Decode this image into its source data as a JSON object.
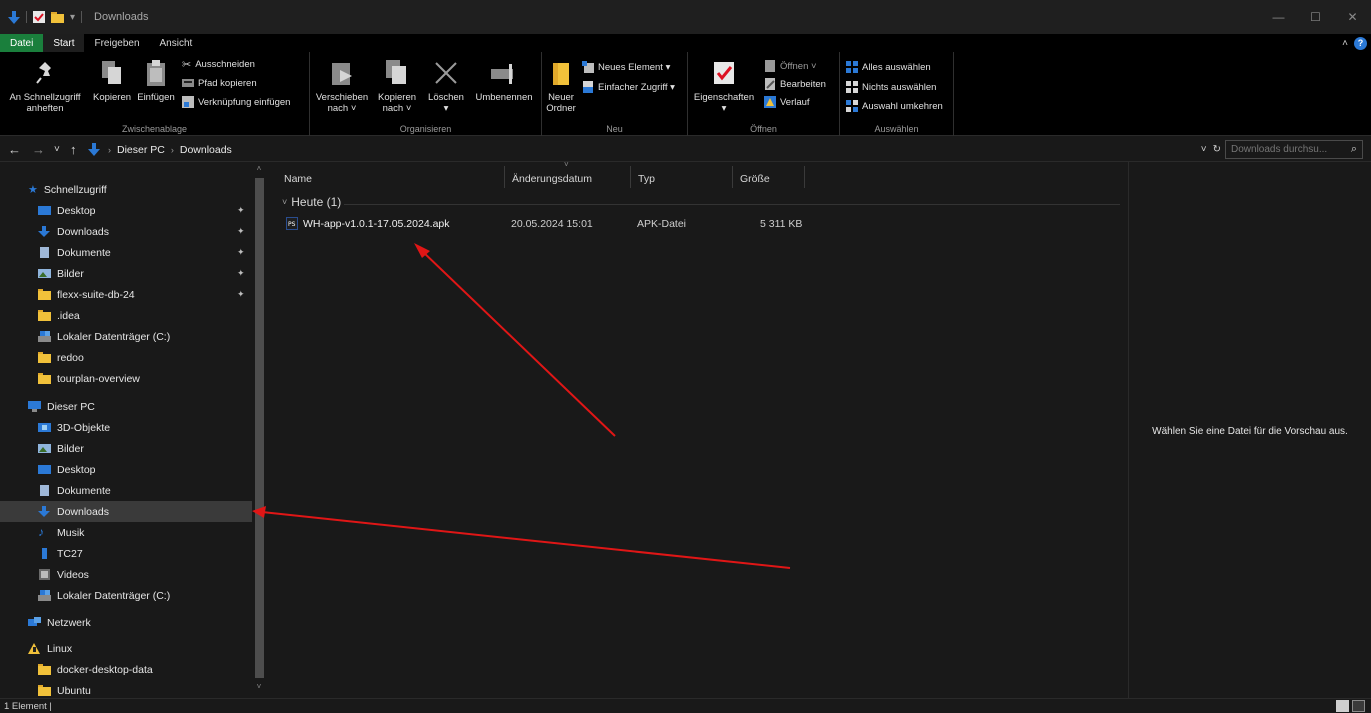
{
  "window": {
    "title": "Downloads",
    "controls": {
      "minimize": "—",
      "maximize": "☐",
      "close": "✕"
    }
  },
  "ribbon_tabs": [
    "Datei",
    "Start",
    "Freigeben",
    "Ansicht"
  ],
  "ribbon": {
    "zwischenablage": {
      "label": "Zwischenablage",
      "pin_quick": "An Schnellzugriff",
      "pin_quick2": "anheften",
      "copy": "Kopieren",
      "paste": "Einfügen",
      "cut": "Ausschneiden",
      "copy_path": "Pfad kopieren",
      "paste_shortcut": "Verknüpfung einfügen"
    },
    "organisieren": {
      "label": "Organisieren",
      "move_to": "Verschieben",
      "move_to2": "nach ˅",
      "copy_to": "Kopieren",
      "copy_to2": "nach ˅",
      "delete": "Löschen",
      "delete2": "▾",
      "rename": "Umbenennen"
    },
    "neu": {
      "label": "Neu",
      "new_folder": "Neuer",
      "new_folder2": "Ordner",
      "new_item": "Neues Element ▾",
      "easy_access": "Einfacher Zugriff ▾"
    },
    "oeffnen": {
      "label": "Öffnen",
      "properties": "Eigenschaften",
      "properties2": "▾",
      "open": "Öffnen ˅",
      "edit": "Bearbeiten",
      "history": "Verlauf"
    },
    "auswaehlen": {
      "label": "Auswählen",
      "select_all": "Alles auswählen",
      "select_none": "Nichts auswählen",
      "invert": "Auswahl umkehren"
    }
  },
  "address": {
    "back": "←",
    "forward": "→",
    "recent": "˅",
    "up": "↑",
    "crumbs": [
      "Dieser PC",
      "Downloads"
    ],
    "sep": "›",
    "dropdown": "˅",
    "refresh": "↻",
    "search_placeholder": "Downloads durchsu...",
    "search_icon": "⌕"
  },
  "nav": {
    "quick_access": "Schnellzugriff",
    "quick_items": [
      "Desktop",
      "Downloads",
      "Dokumente",
      "Bilder",
      "flexx-suite-db-24",
      ".idea",
      "Lokaler Datenträger (C:)",
      "redoo",
      "tourplan-overview"
    ],
    "this_pc": "Dieser PC",
    "pc_items": [
      "3D-Objekte",
      "Bilder",
      "Desktop",
      "Dokumente",
      "Downloads",
      "Musik",
      "TC27",
      "Videos",
      "Lokaler Datenträger (C:)"
    ],
    "network": "Netzwerk",
    "linux": "Linux",
    "linux_items": [
      "docker-desktop-data",
      "Ubuntu"
    ],
    "pin_glyph": "✦",
    "scroll_up": "˄",
    "scroll_down": "˅"
  },
  "filelist": {
    "columns": [
      "Name",
      "Änderungsdatum",
      "Typ",
      "Größe"
    ],
    "sort_indicator": "˅",
    "group": {
      "chevron": "˅",
      "title": "Heute (1)"
    },
    "rows": [
      {
        "name": "WH-app-v1.0.1-17.05.2024.apk",
        "date": "20.05.2024 15:01",
        "type": "APK-Datei",
        "size": "5 311 KB"
      }
    ]
  },
  "preview": {
    "text": "Wählen Sie eine Datei für die Vorschau aus."
  },
  "status": {
    "text": "1 Element  |"
  },
  "colors": {
    "accent_blue": "#2b79d6",
    "folder_yellow": "#f1c13a",
    "file_tab_green": "#1a7f3c",
    "annotation_red": "#e01616"
  },
  "icons": {
    "download_arrow": "download-arrow-icon",
    "folder": "folder-icon",
    "pin": "pin-icon",
    "apk": "apk-file-icon"
  }
}
